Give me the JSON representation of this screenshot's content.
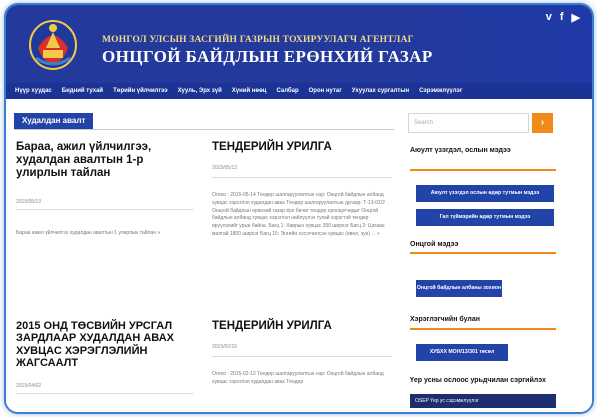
{
  "header": {
    "agency_subtitle": "МОНГОЛ УЛСЫН ЗАСГИЙН ГАЗРЫН ТОХИРУУЛАГЧ АГЕНТЛАГ",
    "agency_title": "ОНЦГОЙ БАЙДЛЫН ЕРӨНХИЙ ГАЗАР",
    "social": [
      "v",
      "f",
      "▶"
    ]
  },
  "nav": {
    "items": [
      "Нүүр хуудас",
      "Бидний тухай",
      "Төрийн үйлчилгээ",
      "Хууль, Эрх зүй",
      "Хүний нөөц",
      "Салбар",
      "Орон нутаг",
      "Ухуулах сургалтын",
      "Сэрэмжлүүлэг"
    ]
  },
  "section": {
    "tab": "Худалдан авалт"
  },
  "posts": [
    {
      "title": "Бараа, ажил үйлчилгээ, худалдан авалтын 1-р улирлын тайлан",
      "date": "2015/05/13",
      "excerpt": "Бараа ажил үйлчилгээ худалдан авалтын 1 улирлын тайлан »"
    },
    {
      "title": "ТЕНДЕРИЙН УРИЛГА",
      "date": "2015/05/13",
      "excerpt": "Огноо : 2015-05-14 Тендер шалгаруулалтын нэр: Онцгой байдлын албанд хувцас хэрэглэл худалдан авах Тендер шалгаруулалтын дугаар: Т-13-02/2 Онцгой байдлын ерөнхий газар ёрх бичиг тендер оролцогчидыг Онцгой байдлын албанд хувцас хэрэглэл нийлүүлэх тухай хэрэгтэй тендер ирүүлэхийг урьж байна. Багц 1: Хаврын хувцас 350 ширхэг Багц 2: Цагаан малгай 1800 ширхэг Багц 15: Энгийн хэсэгчилсэн хувцас (өвөл, зун) ... »"
    },
    {
      "title": "2015 ОНД ТӨСВИЙН УРСГАЛ ЗАРДЛААР ХУДАЛДАН АВАХ ХУВЦАС ХЭРЭГЛЭЛИЙН ЖАГСААЛТ",
      "date": "2015/04/02",
      "excerpt": ""
    },
    {
      "title": "ТЕНДЕРИЙН УРИЛГА",
      "date": "2015/02/16",
      "excerpt": "Огноо : 2015-02-12 Тендер шалгаруулалтын нэр: Онцгой байдлын албанд хувцас хэрэглэл худалдан авах Тендер"
    }
  ],
  "sidebar": {
    "search_placeholder": "Search",
    "search_button": "›",
    "widget1_title": "Аюулт үзэгдэл, ослын мэдээ",
    "widget1_buttons": [
      "Аюулт үзэгдэл ослын өдөр тутмын мэдээ",
      "Гал түймэрийн өдөр тутмын мэдээ"
    ],
    "widget2_title": "Онцгой мэдээ",
    "widget2_buttons": [
      "Онцгой байдлын албаны зохион"
    ],
    "widget3_title": "Хэрэглэгчийн булан",
    "widget3_buttons": [
      "ХУБХХ МОН/13/301 төсөл"
    ],
    "widget4_title": "Үер усны ослоос урьдчилан сэргийлэх",
    "footer_bar": "OSEP Үер ус сэрэмжлүүлэг"
  },
  "colors": {
    "header_blue": "#233a9c",
    "nav_blue": "#1b3395",
    "accent_orange": "#f08a18",
    "button_blue": "#2244a8",
    "frame_blue": "#3b7fd0",
    "title_gold": "#f0d98a"
  }
}
